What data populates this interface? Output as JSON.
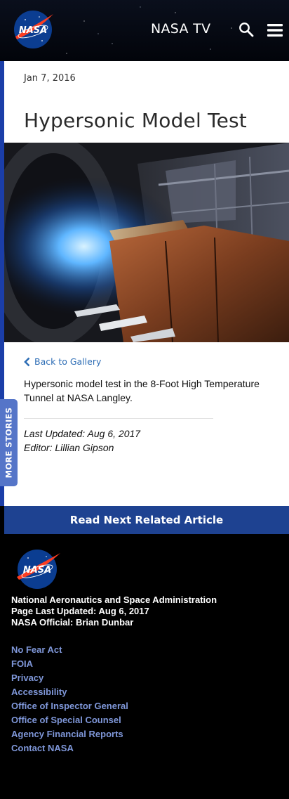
{
  "header": {
    "logo_text": "NASA",
    "title": "NASA TV",
    "search_icon": "search-icon",
    "menu_icon": "hamburger-menu-icon"
  },
  "article": {
    "date": "Jan 7, 2016",
    "title": "Hypersonic Model Test",
    "back_link": "Back to Gallery",
    "caption": "Hypersonic model test in the 8-Foot High Temperature Tunnel at NASA Langley.",
    "last_updated": "Last Updated: Aug 6, 2017",
    "editor": "Editor: Lillian Gipson"
  },
  "side_tab": {
    "label": "MORE STORIES"
  },
  "read_next": {
    "label": "Read Next Related Article"
  },
  "footer": {
    "logo_text": "NASA",
    "agency_name": "National Aeronautics and Space Administration",
    "page_updated": "Page Last Updated: Aug 6, 2017",
    "official": "NASA Official: Brian Dunbar",
    "links": [
      "No Fear Act",
      "FOIA",
      "Privacy",
      "Accessibility",
      "Office of Inspector General",
      "Office of Special Counsel",
      "Agency Financial Reports",
      "Contact NASA"
    ]
  },
  "colors": {
    "accent_blue": "#1e4291",
    "link_blue": "#2d6db5",
    "footer_link": "#7f97d9",
    "side_tab": "#5575c8"
  }
}
